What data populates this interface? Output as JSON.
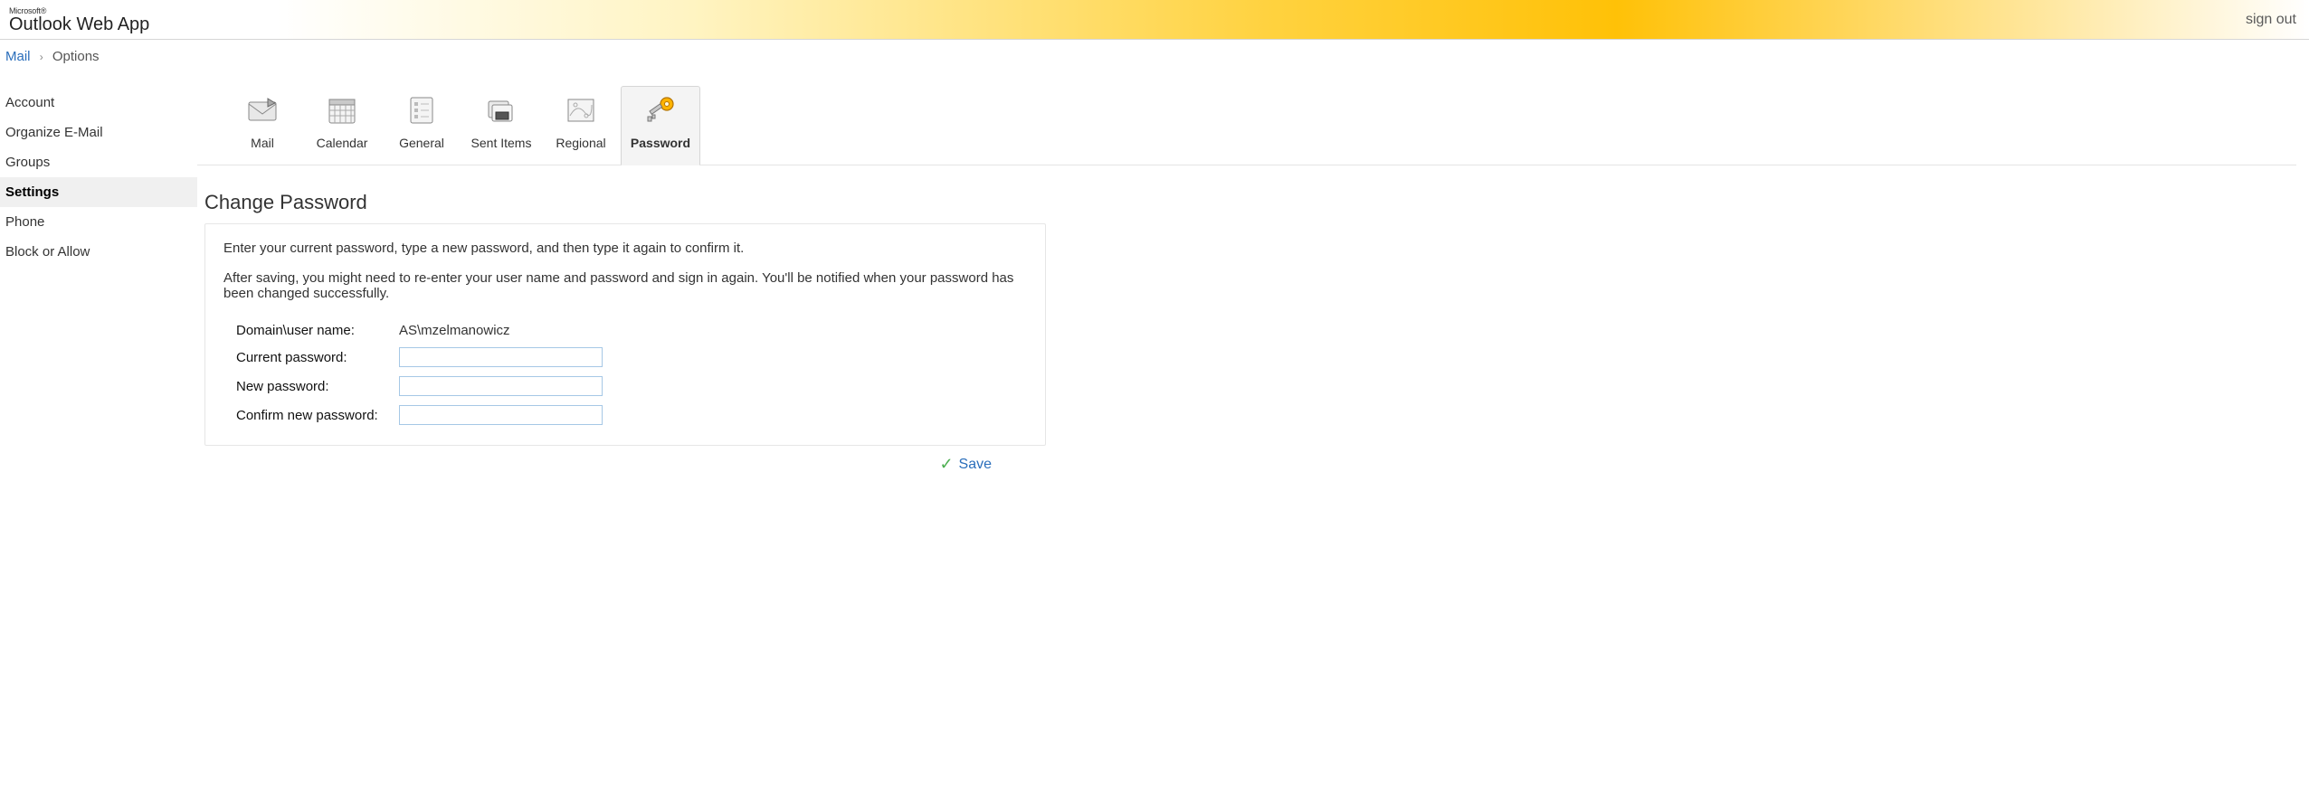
{
  "header": {
    "brand_small": "Microsoft®",
    "brand_main_strong": "Outlook",
    "brand_main_light": "Web App",
    "sign_out": "sign out"
  },
  "breadcrumb": {
    "mail": "Mail",
    "separator": "›",
    "options": "Options"
  },
  "sidebar": {
    "items": [
      {
        "label": "Account",
        "active": false
      },
      {
        "label": "Organize E-Mail",
        "active": false
      },
      {
        "label": "Groups",
        "active": false
      },
      {
        "label": "Settings",
        "active": true
      },
      {
        "label": "Phone",
        "active": false
      },
      {
        "label": "Block or Allow",
        "active": false
      }
    ]
  },
  "tabs": {
    "items": [
      {
        "label": "Mail",
        "icon": "mail-icon",
        "active": false
      },
      {
        "label": "Calendar",
        "icon": "calendar-icon",
        "active": false
      },
      {
        "label": "General",
        "icon": "general-icon",
        "active": false
      },
      {
        "label": "Sent Items",
        "icon": "sent-items-icon",
        "active": false
      },
      {
        "label": "Regional",
        "icon": "regional-icon",
        "active": false
      },
      {
        "label": "Password",
        "icon": "password-icon",
        "active": true
      }
    ]
  },
  "panel": {
    "title": "Change Password",
    "instruction": "Enter your current password, type a new password, and then type it again to confirm it.",
    "note": "After saving, you might need to re-enter your user name and password and sign in again. You'll be notified when your password has been changed successfully.",
    "fields": {
      "domain_user_label": "Domain\\user name:",
      "domain_user_value": "AS\\mzelmanowicz",
      "current_password_label": "Current password:",
      "current_password_value": "",
      "new_password_label": "New password:",
      "new_password_value": "",
      "confirm_password_label": "Confirm new password:",
      "confirm_password_value": ""
    }
  },
  "actions": {
    "save": "Save"
  }
}
